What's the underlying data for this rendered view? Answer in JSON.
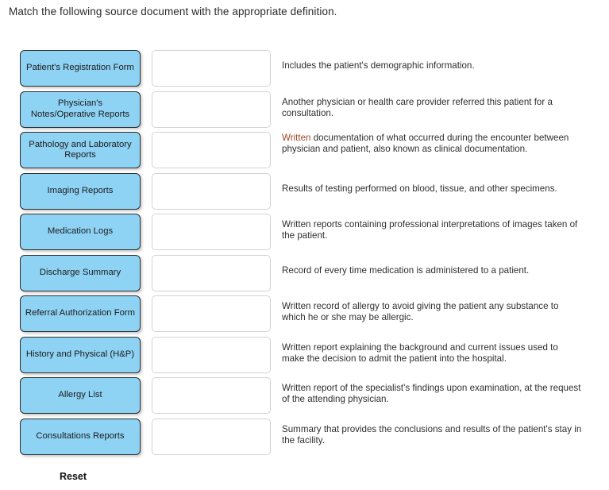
{
  "heading": "Match the following source document with the appropriate definition.",
  "reset_label": "Reset",
  "colors": {
    "chip_fill": "#8ed2f4",
    "chip_border": "#2e2e2e",
    "dropzone_border": "#d3d3d3",
    "text": "#2f2f2f",
    "highlight_written": "#9c4a28",
    "page_background": "#ffffff"
  },
  "sources": [
    {
      "label": "Patient's Registration Form"
    },
    {
      "label": "Physician's Notes/Operative Reports"
    },
    {
      "label": "Pathology and Laboratory Reports"
    },
    {
      "label": "Imaging Reports"
    },
    {
      "label": "Medication Logs"
    },
    {
      "label": "Discharge Summary"
    },
    {
      "label": "Referral Authorization Form"
    },
    {
      "label": "History and Physical (H&P)"
    },
    {
      "label": "Allergy List"
    },
    {
      "label": "Consultations Reports"
    }
  ],
  "drop_zones": [
    {
      "value": ""
    },
    {
      "value": ""
    },
    {
      "value": ""
    },
    {
      "value": ""
    },
    {
      "value": ""
    },
    {
      "value": ""
    },
    {
      "value": ""
    },
    {
      "value": ""
    },
    {
      "value": ""
    },
    {
      "value": ""
    }
  ],
  "definitions": [
    {
      "text": "Includes the patient's demographic information.",
      "lines": 1,
      "highlight_first_word": false
    },
    {
      "text": "Another physician or health care provider referred this patient for a consultation.",
      "lines": 2,
      "highlight_first_word": false
    },
    {
      "text": "Written documentation of what occurred during the encounter between physician and patient, also known as clinical documentation.",
      "lines": 3,
      "highlight_first_word": true,
      "first_word": "Written",
      "rest": " documentation of what occurred during the encounter between physician and patient, also known as clinical documentation."
    },
    {
      "text": "Results of testing performed on blood, tissue, and other specimens.",
      "lines": 1,
      "highlight_first_word": false
    },
    {
      "text": "Written reports containing professional interpretations of images taken of the patient.",
      "lines": 2,
      "highlight_first_word": false
    },
    {
      "text": "Record of every time medication is administered to a patient.",
      "lines": 1,
      "highlight_first_word": false
    },
    {
      "text": "Written record of allergy to avoid giving the patient any substance to which he or she may be allergic.",
      "lines": 2,
      "highlight_first_word": false
    },
    {
      "text": "Written report explaining the background and current issues used to make the decision to admit the patient into the hospital.",
      "lines": 2,
      "highlight_first_word": false
    },
    {
      "text": "Written report of the specialist's findings upon examination, at the request of the attending physician.",
      "lines": 2,
      "highlight_first_word": false
    },
    {
      "text": "Summary that provides the conclusions and results of the patient's stay in the facility.",
      "lines": 2,
      "highlight_first_word": false
    }
  ]
}
